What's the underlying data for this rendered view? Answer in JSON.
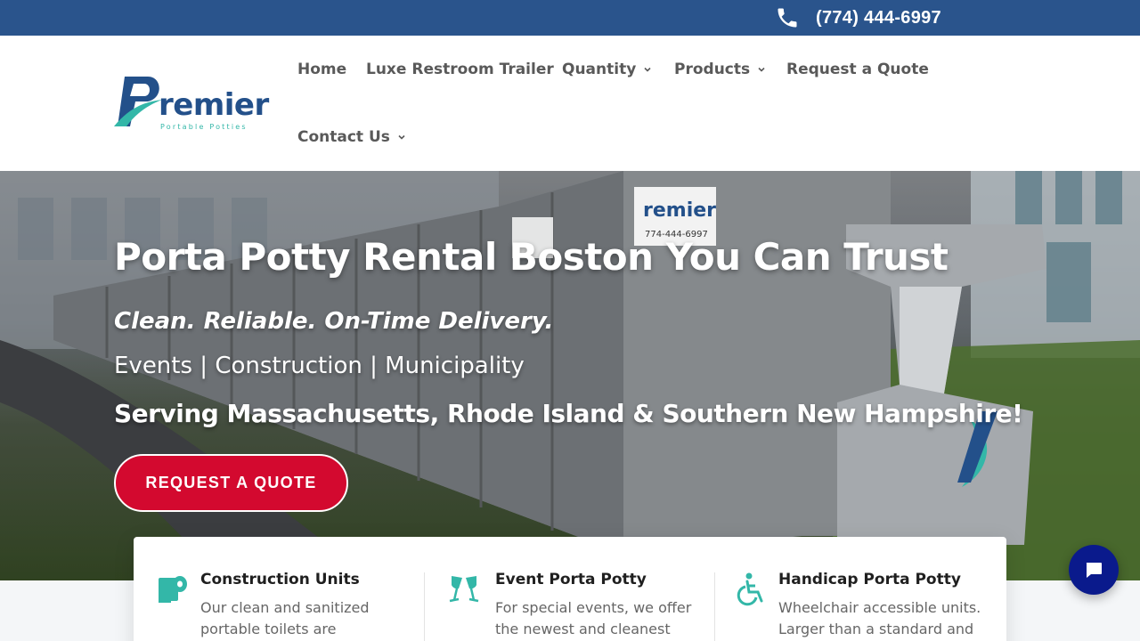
{
  "topbar": {
    "phone": "(774) 444-6997"
  },
  "logo": {
    "word": "remier",
    "sub": "Portable Potties"
  },
  "nav": {
    "items": [
      {
        "label": "Home"
      },
      {
        "label": "Luxe Restroom Trailer"
      },
      {
        "label": "Quantity"
      },
      {
        "label": "Products"
      },
      {
        "label": "Request a Quote"
      },
      {
        "label": "Contact Us"
      }
    ]
  },
  "hero": {
    "title": "Porta Potty Rental Boston You Can Trust",
    "tagline": "Clean. Reliable. On-Time Delivery.",
    "segments": "Events | Construction | Municipality",
    "serving": "Serving Massachusetts, Rhode Island & Southern New Hampshire!",
    "cta": "REQUEST A QUOTE",
    "unit_label": "remier",
    "unit_phone": "774-444-6997"
  },
  "cards": [
    {
      "title": "Construction Units",
      "text": "Our clean and sanitized portable toilets are",
      "icon": "toilet-paper-icon"
    },
    {
      "title": "Event Porta Potty",
      "text": "For special events, we offer the newest and cleanest",
      "icon": "champagne-glasses-icon"
    },
    {
      "title": "Handicap Porta Potty",
      "text": "Wheelchair accessible units. Larger than a standard and",
      "icon": "wheelchair-icon"
    }
  ],
  "colors": {
    "topbar": "#2a548c",
    "cta": "#d3092f",
    "teal": "#33b7a8",
    "brand_blue": "#23508a",
    "chat": "#0a1a8c"
  }
}
